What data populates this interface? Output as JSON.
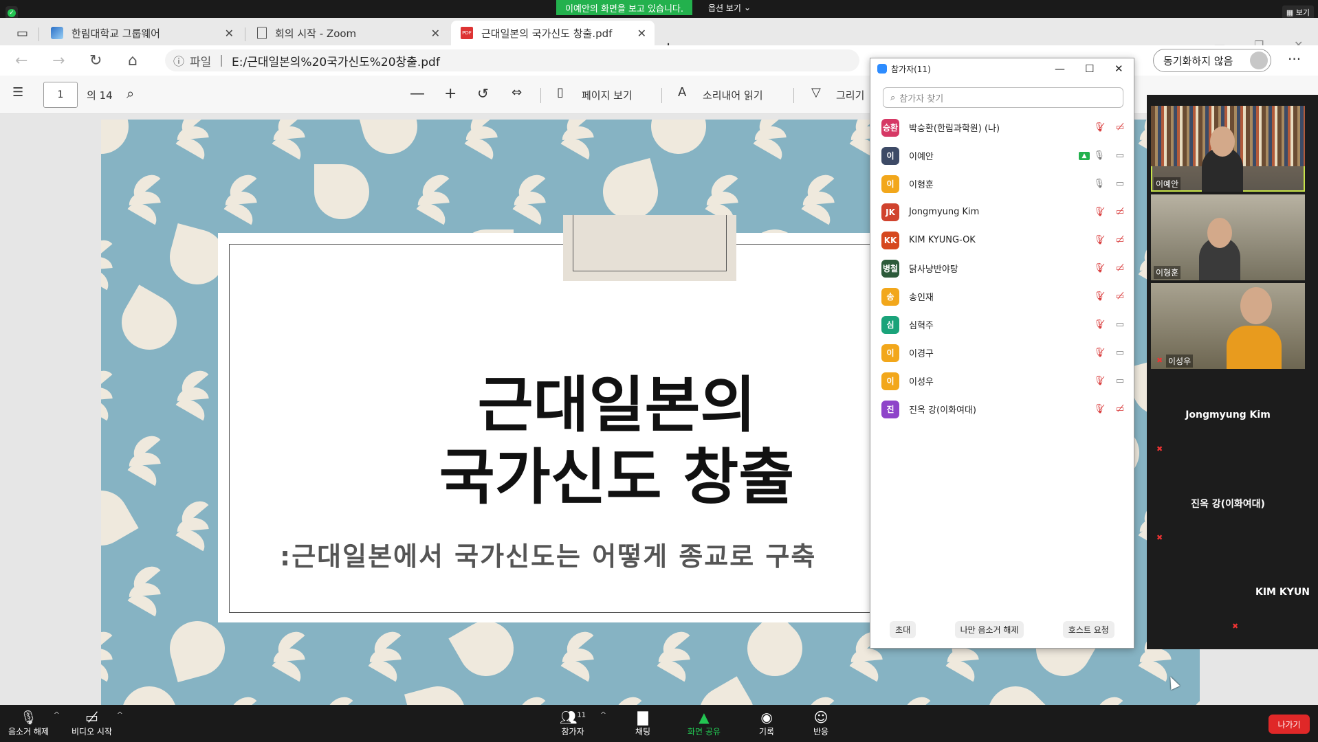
{
  "zoom_top": {
    "share_banner": "이예안의 화면을 보고 있습니다.",
    "options": "옵션 보기",
    "view": "보기"
  },
  "browser": {
    "tabs": [
      {
        "label": "한림대학교 그룹웨어"
      },
      {
        "label": "회의 시작 - Zoom"
      },
      {
        "label": "근대일본의 국가신도 창출.pdf"
      }
    ],
    "url_scheme": "파일",
    "url": "E:/근대일본의%20국가신도%20창출.pdf",
    "sync_label": "동기화하지 않음"
  },
  "pdf_toolbar": {
    "page_current": "1",
    "page_total": "의 14",
    "page_view": "페이지 보기",
    "read_aloud": "소리내어 읽기",
    "draw": "그리기"
  },
  "slide": {
    "title_line1": "근대일본의",
    "title_line2": "국가신도 창출",
    "subtitle": ":근대일본에서 국가신도는 어떻게 종교로 구축"
  },
  "participants": {
    "title": "참가자(11)",
    "search_placeholder": "참가자 찾기",
    "list": [
      {
        "avatar": "승환",
        "color": "#d63865",
        "name": "박승환(한림과학원) (나)",
        "mic": "muted",
        "cam": "off"
      },
      {
        "avatar": "이",
        "color": "#3d4a66",
        "name": "이예안",
        "mic": "on",
        "cam": "on",
        "sharing": true
      },
      {
        "avatar": "이",
        "color": "#f2a71b",
        "name": "이형훈",
        "mic": "on",
        "cam": "on"
      },
      {
        "avatar": "JK",
        "color": "#d0432e",
        "name": "Jongmyung Kim",
        "mic": "muted",
        "cam": "off"
      },
      {
        "avatar": "KK",
        "color": "#d6481f",
        "name": "KIM KYUNG-OK",
        "mic": "muted",
        "cam": "off"
      },
      {
        "avatar": "병철",
        "color": "#2c5a3a",
        "name": "닭사냥반야탕",
        "mic": "muted",
        "cam": "off"
      },
      {
        "avatar": "송",
        "color": "#f2a71b",
        "name": "송인재",
        "mic": "muted",
        "cam": "off"
      },
      {
        "avatar": "심",
        "color": "#1aa37a",
        "name": "심혁주",
        "mic": "muted",
        "cam": "on"
      },
      {
        "avatar": "이",
        "color": "#f2a71b",
        "name": "이경구",
        "mic": "muted",
        "cam": "on"
      },
      {
        "avatar": "이",
        "color": "#f2a71b",
        "name": "이성우",
        "mic": "muted",
        "cam": "on"
      },
      {
        "avatar": "진",
        "color": "#8e44c9",
        "name": "진옥 강(이화여대)",
        "mic": "muted",
        "cam": "off"
      }
    ],
    "invite": "초대",
    "unmute_me": "나만 음소거 해제",
    "ask_host": "호스트 요청"
  },
  "video": {
    "tiles": [
      {
        "label": "이예안",
        "type": "cam"
      },
      {
        "label": "이형훈",
        "type": "cam"
      },
      {
        "label": "이성우",
        "type": "cam"
      },
      {
        "label": "Jongmyung Kim",
        "type": "name"
      },
      {
        "label": "진옥 강(이화여대)",
        "type": "name"
      },
      {
        "label": "KIM KYUN",
        "type": "name"
      }
    ]
  },
  "zoom_bottom": {
    "unmute": "음소거 해제",
    "video_start": "비디오 시작",
    "participants": "참가자",
    "participants_count": "11",
    "chat": "채팅",
    "share": "화면 공유",
    "record": "기록",
    "reactions": "반응",
    "leave": "나가기"
  },
  "colors": {
    "accent_green": "#23b14d",
    "leave_red": "#e02828",
    "slide_bg": "#86b3c3"
  }
}
